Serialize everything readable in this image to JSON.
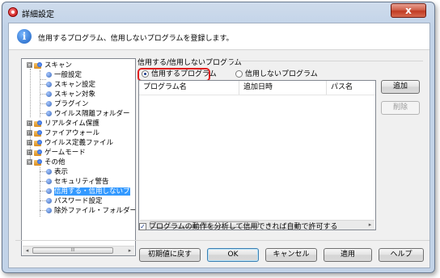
{
  "window": {
    "title": "詳細設定",
    "close_label": "x"
  },
  "info": {
    "icon": "info-icon",
    "text": "信用するプログラム、信用しないプログラムを登録します。",
    "icon_glyph": "i"
  },
  "tree": {
    "items": [
      {
        "label": "スキャン",
        "toggle": "⊟",
        "type": "folder"
      },
      {
        "label": "一般設定",
        "type": "leaf"
      },
      {
        "label": "スキャン設定",
        "type": "leaf"
      },
      {
        "label": "スキャン対象",
        "type": "leaf"
      },
      {
        "label": "プラグイン",
        "type": "leaf"
      },
      {
        "label": "ウイルス隔離フォルダー",
        "type": "leaf"
      },
      {
        "label": "リアルタイム保護",
        "toggle": "⊞",
        "type": "folder"
      },
      {
        "label": "ファイアウォール",
        "toggle": "⊞",
        "type": "folder"
      },
      {
        "label": "ウイルス定義ファイル",
        "toggle": "⊞",
        "type": "folder"
      },
      {
        "label": "ゲームモード",
        "toggle": "⊞",
        "type": "folder"
      },
      {
        "label": "その他",
        "toggle": "⊟",
        "type": "folder"
      },
      {
        "label": "表示",
        "type": "leaf"
      },
      {
        "label": "セキュリティ警告",
        "type": "leaf"
      },
      {
        "label": "信用する・信用しないプ",
        "type": "leaf",
        "selected": true
      },
      {
        "label": "パスワード設定",
        "type": "leaf"
      },
      {
        "label": "除外ファイル・フォルダー",
        "type": "leaf"
      }
    ],
    "scroll_left": "◂",
    "scroll_right": "▸",
    "scroll_grip": "III"
  },
  "group": {
    "label": "信用する/信用しないプログラム",
    "radio_trusted": "信用するプログラム",
    "radio_untrusted": "信用しないプログラム",
    "selected": "trusted"
  },
  "list": {
    "columns": [
      "プログラム名",
      "追加日時",
      "パス名"
    ],
    "rows": [],
    "scroll_left": "◂",
    "scroll_right": "▸",
    "scroll_grip": "III"
  },
  "side_buttons": {
    "add": "追加",
    "delete": "削除"
  },
  "checkbox": {
    "label": "プログラムの動作を分析して信用できれば自動で許可する",
    "checked": true,
    "mark": "✓"
  },
  "footer": {
    "reset": "初期値に戻す",
    "ok": "OK",
    "cancel": "キャンセル",
    "apply": "適用",
    "help": "ヘルプ"
  },
  "colors": {
    "selection": "#3399ff",
    "highlight_frame": "#e02020",
    "close_button": "#c13b22"
  }
}
